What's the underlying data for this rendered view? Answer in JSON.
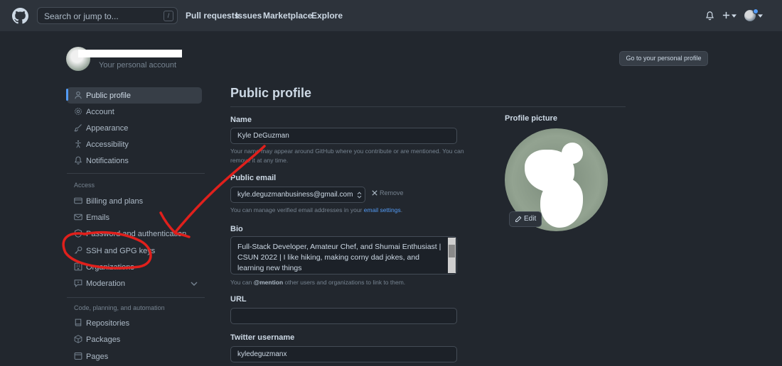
{
  "header": {
    "search_placeholder": "Search or jump to...",
    "search_key": "/",
    "nav": [
      "Pull requests",
      "Issues",
      "Marketplace",
      "Explore"
    ]
  },
  "account": {
    "subtitle": "Your personal account",
    "profile_button": "Go to your personal profile"
  },
  "sidebar": {
    "items_top": [
      {
        "label": "Public profile",
        "icon": "person-icon"
      },
      {
        "label": "Account",
        "icon": "gear-icon"
      },
      {
        "label": "Appearance",
        "icon": "paintbrush-icon"
      },
      {
        "label": "Accessibility",
        "icon": "accessibility-icon"
      },
      {
        "label": "Notifications",
        "icon": "bell-icon"
      }
    ],
    "access_heading": "Access",
    "items_access": [
      {
        "label": "Billing and plans",
        "icon": "credit-card-icon"
      },
      {
        "label": "Emails",
        "icon": "mail-icon"
      },
      {
        "label": "Password and authentication",
        "icon": "shield-lock-icon"
      },
      {
        "label": "SSH and GPG keys",
        "icon": "key-icon"
      },
      {
        "label": "Organizations",
        "icon": "organization-icon"
      },
      {
        "label": "Moderation",
        "icon": "report-icon"
      }
    ],
    "code_heading": "Code, planning, and automation",
    "items_code": [
      {
        "label": "Repositories",
        "icon": "repo-icon"
      },
      {
        "label": "Packages",
        "icon": "package-icon"
      },
      {
        "label": "Pages",
        "icon": "browser-icon"
      }
    ]
  },
  "main": {
    "title": "Public profile",
    "name_label": "Name",
    "name_value": "Kyle DeGuzman",
    "name_hint_1": "Your name may appear around GitHub where you contribute or are mentioned. You can",
    "name_hint_2": "remove it at any time.",
    "email_label": "Public email",
    "email_value": "kyle.deguzmanbusiness@gmail.com",
    "remove_label": "Remove",
    "email_hint_prefix": "You can manage verified email addresses in your",
    "email_hint_link": "email settings",
    "email_hint_suffix": ".",
    "bio_label": "Bio",
    "bio_value": "Full-Stack Developer, Amateur Chef, and Shumai Enthusiast | CSUN 2022  | I like hiking, making corny dad jokes, and learning new things",
    "bio_hint_prefix": "You can",
    "bio_hint_mention": "@mention",
    "bio_hint_suffix": "other users and organizations to link to them.",
    "url_label": "URL",
    "url_value": "",
    "twitter_label": "Twitter username",
    "twitter_value": "kyledeguzmanx",
    "picture_label": "Profile picture",
    "edit_label": "Edit"
  },
  "colors": {
    "background": "#22272e",
    "header": "#2d333b",
    "accent": "#539bf5",
    "annotation": "#e0201c"
  }
}
